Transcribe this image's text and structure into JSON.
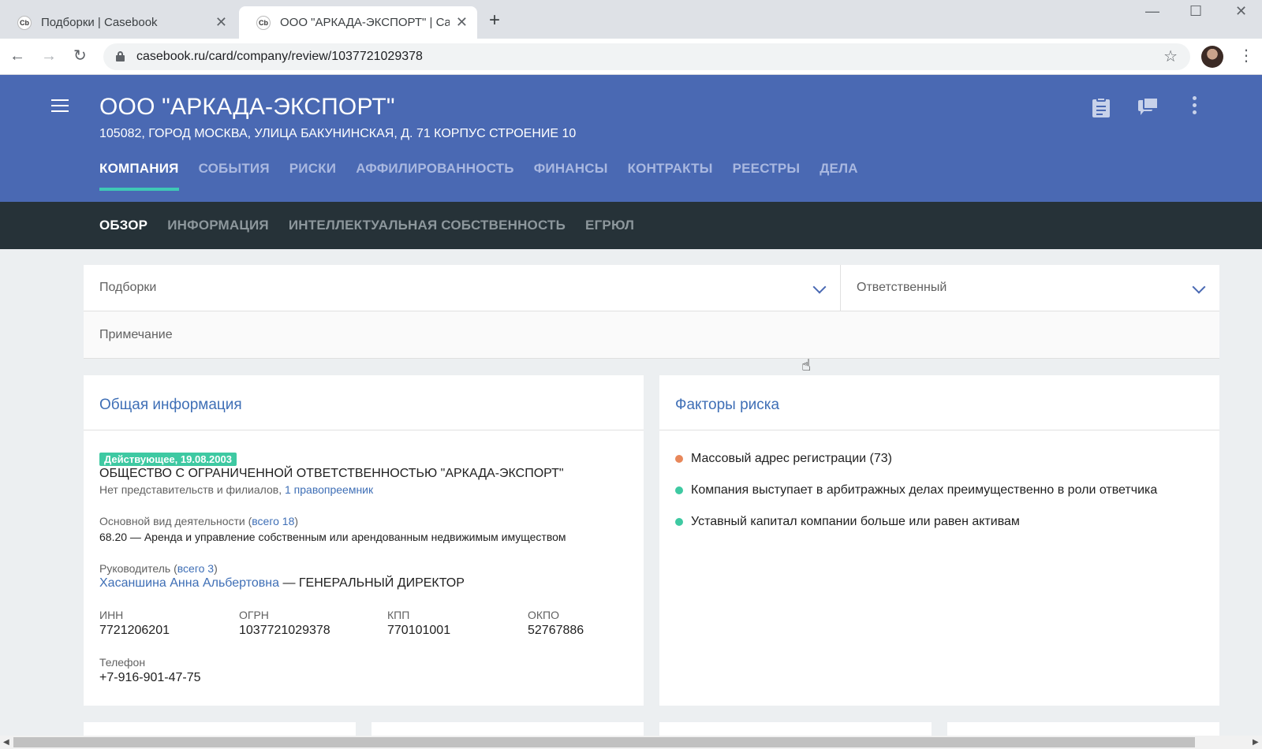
{
  "browser": {
    "tabs": [
      {
        "favicon": "Cb",
        "title": "Подборки | Casebook",
        "close": "✕"
      },
      {
        "favicon": "Cb",
        "title": "ООО \"АРКАДА-ЭКСПОРТ\" | Casebook",
        "close": "✕"
      }
    ],
    "new_tab": "+",
    "url": "casebook.ru/card/company/review/1037721029378",
    "window_controls": {
      "minimize": "—",
      "maximize": "☐",
      "close": "✕"
    },
    "nav": {
      "back": "←",
      "forward": "→",
      "reload": "↻",
      "star": "☆",
      "menu": "⋮"
    }
  },
  "header": {
    "title": "ООО \"АРКАДА-ЭКСПОРТ\"",
    "address": "105082, ГОРОД МОСКВА, УЛИЦА БАКУНИНСКАЯ, Д. 71 КОРПУС СТРОЕНИЕ 10",
    "main_tabs": [
      "КОМПАНИЯ",
      "СОБЫТИЯ",
      "РИСКИ",
      "АФФИЛИРОВАННОСТЬ",
      "ФИНАНСЫ",
      "КОНТРАКТЫ",
      "РЕЕСТРЫ",
      "ДЕЛА"
    ],
    "active_main_tab": "КОМПАНИЯ",
    "sub_tabs": [
      "ОБЗОР",
      "ИНФОРМАЦИЯ",
      "ИНТЕЛЛЕКТУАЛЬНАЯ СОБСТВЕННОСТЬ",
      "ЕГРЮЛ"
    ],
    "active_sub_tab": "ОБЗОР",
    "accent_color": "#3ec9b6",
    "brand_color": "#4a69b3"
  },
  "filters": {
    "collections_placeholder": "Подборки",
    "responsible_placeholder": "Ответственный",
    "note_placeholder": "Примечание"
  },
  "general": {
    "title": "Общая информация",
    "status_badge": "Действующее, 19.08.2003",
    "full_name": "ОБЩЕСТВО С ОГРАНИЧЕННОЙ ОТВЕТСТВЕННОСТЬЮ \"АРКАДА-ЭКСПОРТ\"",
    "branches_text": "Нет представительств и филиалов, ",
    "successor_link": "1 правопреемник",
    "activity_label": "Основной вид деятельности (",
    "activity_link": "всего 18",
    "activity_close": ")",
    "activity_value": "68.20 — Аренда и управление собственным или арендованным недвижимым имуществом",
    "head_label": "Руководитель (",
    "head_link": "всего 3",
    "head_close": ")",
    "head_name": "Хасаншина Анна Альбертовна",
    "head_role": " — ГЕНЕРАЛЬНЫЙ ДИРЕКТОР",
    "requisites": [
      {
        "label": "ИНН",
        "value": "7721206201"
      },
      {
        "label": "ОГРН",
        "value": "1037721029378"
      },
      {
        "label": "КПП",
        "value": "770101001"
      },
      {
        "label": "ОКПО",
        "value": "52767886"
      }
    ],
    "phone_label": "Телефон",
    "phone_value": "+7-916-901-47-75"
  },
  "risks": {
    "title": "Факторы риска",
    "items": [
      {
        "text": "Массовый адрес регистрации (73)",
        "color": "#e8875a"
      },
      {
        "text": "Компания выступает в арбитражных делах преимущественно в роли ответчика",
        "color": "#3ec9a2"
      },
      {
        "text": "Уставный капитал компании больше или равен активам",
        "color": "#3ec9a2"
      }
    ]
  }
}
